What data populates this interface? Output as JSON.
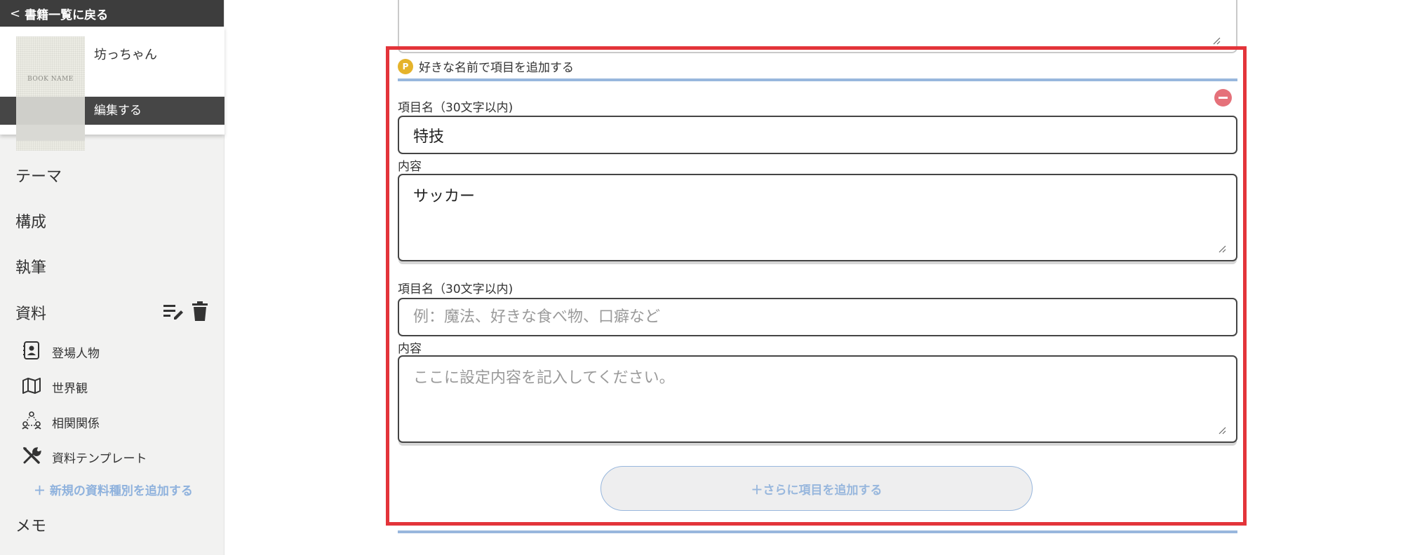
{
  "sidebar": {
    "back_label": "書籍一覧に戻る",
    "book": {
      "cover_text": "BOOK NAME",
      "title": "坊っちゃん",
      "edit_label": "編集する"
    },
    "nav": {
      "theme": "テーマ",
      "structure": "構成",
      "writing": "執筆",
      "materials": "資料",
      "memo": "メモ"
    },
    "material_items": [
      {
        "label": "登場人物",
        "icon": "person-card-icon"
      },
      {
        "label": "世界観",
        "icon": "map-icon"
      },
      {
        "label": "相関関係",
        "icon": "relationship-icon"
      },
      {
        "label": "資料テンプレート",
        "icon": "tools-icon"
      }
    ],
    "add_type_label": "＋ 新規の資料種別を追加する"
  },
  "main": {
    "section_title": "好きな名前で項目を追加する",
    "coin_letter": "P",
    "items": [
      {
        "name_label": "項目名（30文字以内)",
        "name_value": "特技",
        "name_placeholder": "",
        "content_label": "内容",
        "content_value": "サッカー",
        "content_placeholder": ""
      },
      {
        "name_label": "項目名（30文字以内)",
        "name_value": "",
        "name_placeholder": "例：魔法、好きな食べ物、口癖など",
        "content_label": "内容",
        "content_value": "",
        "content_placeholder": "ここに設定内容を記入してください。"
      }
    ],
    "add_more_label": "＋さらに項目を追加する"
  },
  "colors": {
    "highlight_frame": "#e3343a",
    "accent_blue": "#98b7dd",
    "remove_button": "#e5717a",
    "coin": "#e5b32b",
    "dark_bar": "#3d3d3d"
  }
}
